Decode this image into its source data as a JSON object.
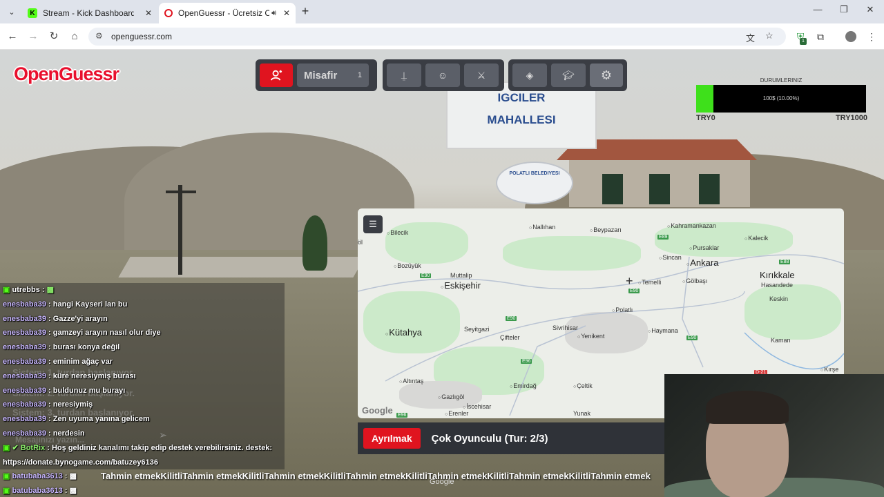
{
  "browser": {
    "tabs": [
      {
        "title": "Stream - Kick Dashboard",
        "favicon": "kick-icon"
      },
      {
        "title": "OpenGuessr - Ücretsiz Coğ",
        "favicon": "openguessr-icon"
      }
    ],
    "url": "openguessr.com",
    "extension_badge": "1"
  },
  "game": {
    "logo": "OpenGuessr",
    "player_name": "Misafir",
    "player_count": "1",
    "budget": {
      "label": "DURUMLERINIZ",
      "percent_text": "100$ (10.00%)",
      "fill_fraction": 0.1,
      "min_label": "TRY0",
      "max_label": "TRY1000"
    },
    "leave_button": "Ayrılmak",
    "round_info": "Çok Oyunculu (Tur: 2/3)",
    "map_attribution": "Google",
    "watermark": "Google"
  },
  "scene_signs": {
    "sign_line1": "IGCILER",
    "sign_line2": "MAHALLESI",
    "seal": "POLATLI BELEDIYESI"
  },
  "map_labels": {
    "cities": [
      {
        "name": "Bilecik",
        "big": false
      },
      {
        "name": "Nallıhan",
        "big": false
      },
      {
        "name": "Beypazarı",
        "big": false
      },
      {
        "name": "Kahramankazan",
        "big": false
      },
      {
        "name": "Kalecik",
        "big": false
      },
      {
        "name": "Pursaklar",
        "big": false
      },
      {
        "name": "Sincan",
        "big": false
      },
      {
        "name": "Ankara",
        "big": true
      },
      {
        "name": "Kırıkkale",
        "big": true
      },
      {
        "name": "Hasandede",
        "big": false
      },
      {
        "name": "Bozüyük",
        "big": false
      },
      {
        "name": "Muttalip",
        "big": false
      },
      {
        "name": "Eskişehir",
        "big": true
      },
      {
        "name": "Temelli",
        "big": false
      },
      {
        "name": "Gölbaşı",
        "big": false
      },
      {
        "name": "Keskin",
        "big": false
      },
      {
        "name": "Polatlı",
        "big": false
      },
      {
        "name": "Kütahya",
        "big": true
      },
      {
        "name": "Seyitgazi",
        "big": false
      },
      {
        "name": "Sivrihisar",
        "big": false
      },
      {
        "name": "Çifteler",
        "big": false
      },
      {
        "name": "Yenikent",
        "big": false
      },
      {
        "name": "Haymana",
        "big": false
      },
      {
        "name": "Kaman",
        "big": false
      },
      {
        "name": "Altıntaş",
        "big": false
      },
      {
        "name": "Emirdağ",
        "big": false
      },
      {
        "name": "Çeltik",
        "big": false
      },
      {
        "name": "Gazlıgöl",
        "big": false
      },
      {
        "name": "İscehisar",
        "big": false
      },
      {
        "name": "Erenler",
        "big": false
      },
      {
        "name": "Yunak",
        "big": false
      },
      {
        "name": "Kırşe",
        "big": false
      },
      {
        "name": "öl",
        "big": false
      }
    ],
    "highways": [
      "E89",
      "E88",
      "E90",
      "E90",
      "E90",
      "E96",
      "E90",
      "D-21",
      "E96"
    ]
  },
  "chat": {
    "messages": [
      {
        "user": "utrebbs",
        "text": "",
        "bot": false
      },
      {
        "user": "enesbaba39",
        "text": "hangi Kayseri lan bu",
        "bot": false
      },
      {
        "user": "enesbaba39",
        "text": "Gazze'yi arayın",
        "bot": false
      },
      {
        "user": "enesbaba39",
        "text": "gamzeyi arayın nasıl olur diye",
        "bot": false
      },
      {
        "user": "enesbaba39",
        "text": "burası konya değil",
        "bot": false
      },
      {
        "user": "enesbaba39",
        "text": "eminim ağaç var",
        "bot": false
      },
      {
        "user": "enesbaba39",
        "text": "küre neresiymiş burası",
        "bot": false
      },
      {
        "user": "enesbaba39",
        "text": "buldunuz mu burayı",
        "bot": false
      },
      {
        "user": "enesbaba39",
        "text": "neresiymiş",
        "bot": false
      },
      {
        "user": "enesbaba39",
        "text": "Zen uyuma yanına gelicem",
        "bot": false
      },
      {
        "user": "enesbaba39",
        "text": "nerdesin",
        "bot": false
      },
      {
        "user": "BotRix",
        "text": "Hoş geldiniz kanalımı takip edip destek verebilirsiniz. destek:",
        "bot": true
      }
    ],
    "link_line": "https://donate.bynogame.com/batuzey6136",
    "last_users": [
      "batubaba3613",
      "batubaba3613"
    ],
    "ghost_system": [
      "Sistem: 1. turdan başlanıyor.",
      "Sistem: 2. turdan başlanıyor.",
      "Sistem: 3. turdan başlanıyor."
    ],
    "ghost_input": "Mesajınızı yazın...",
    "ticker": "Tahmin etmekKilitliTahmin etmekKilitliTahmin etmekKilitliTahmin etmekKilitliTahmin etmekKilitliTahmin etmekKilitliTahmin etmek"
  },
  "colors": {
    "accent": "#e0141f",
    "budget_fill": "#3ee01b",
    "map_green": "#c9e9c7"
  }
}
